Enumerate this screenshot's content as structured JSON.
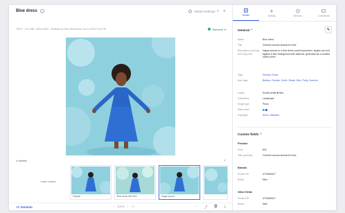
{
  "header": {
    "title": "Blue dress",
    "variant_settings": "Variant settings",
    "meta": "JPEG · 15.4 MB · 6000×4000 · Modified by Nora Rosenthal Jun 11 2024 3:04 PM",
    "status": "Selected"
  },
  "variants": {
    "heading": "4 variants",
    "add_label": "+ Add variant",
    "thumbs": [
      {
        "caption": "Original",
        "selected": false
      },
      {
        "caption": "Blue dress with Red",
        "selected": false
      },
      {
        "caption": "Image source",
        "selected": true
      },
      {
        "caption": "",
        "selected": false
      }
    ]
  },
  "bottom": {
    "variants_link": "+1 Variants",
    "zoom_minus": "−",
    "zoom_value": "100%",
    "zoom_plus": "+"
  },
  "panel": {
    "tabs": [
      {
        "label": "Details",
        "icon": "details-icon",
        "active": true
      },
      {
        "label": "Activity",
        "icon": "activity-icon",
        "active": false
      },
      {
        "label": "Versions",
        "icon": "versions-icon",
        "active": false
      },
      {
        "label": "Comments",
        "icon": "comments-icon",
        "active": false
      }
    ],
    "general_heading": "General",
    "fields": [
      {
        "key": "Name",
        "value": "Blue dress"
      },
      {
        "key": "Title",
        "value": "Cheerful woman dressed in blue"
      },
      {
        "key": "Description and long form copy text",
        "value": "Happy woman in a blue dress, joyful expression, laughs out loud against a blue background with balloons, generated as a curated studio photo."
      },
      {
        "key": "Tags",
        "value": "Woman, Dress",
        "link": true
      },
      {
        "key": "Auto tags",
        "value": "Balloon, Fashion, Smile, Studio, Blue, Party, Summer",
        "link": true
      },
      {
        "key": "Labels",
        "value": "Social media  ■ New"
      },
      {
        "key": "Orientation",
        "value": "Landscape"
      },
      {
        "key": "Image type",
        "value": "Photo"
      },
      {
        "key": "Main colors",
        "value": ""
      },
      {
        "key": "Copyright",
        "value": "Stock, Standard",
        "link": true
      }
    ],
    "custom_heading": "Custom fields",
    "groups": [
      {
        "title": "Product",
        "fields": [
          {
            "key": "Price",
            "value": "$49"
          },
          {
            "key": "Title (optional)",
            "value": "Cheerful woman dressed in blue"
          }
        ]
      },
      {
        "title": "Brands",
        "fields": [
          {
            "key": "Product ID",
            "value": "4723483627"
          },
          {
            "key": "Brand",
            "value": "Nike"
          }
        ]
      },
      {
        "title": "Other fields",
        "fields": [
          {
            "key": "Product ID",
            "value": "4723483627"
          },
          {
            "key": "Brand",
            "value": "Nike"
          }
        ]
      }
    ],
    "colors": [
      "#3aa0c8",
      "#2456b8"
    ]
  }
}
